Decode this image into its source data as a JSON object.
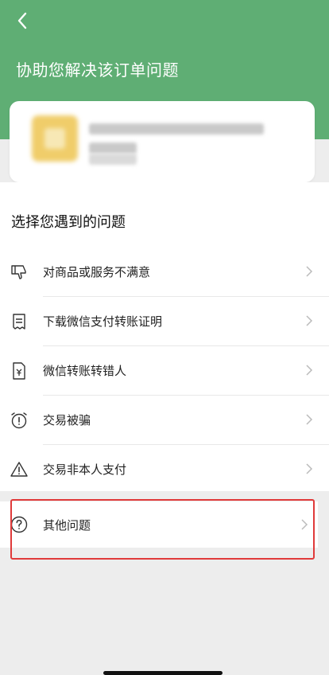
{
  "header": {
    "title": "协助您解决该订单问题",
    "back_icon": "chevron-left-icon",
    "bg_color": "#5fae74"
  },
  "order_card": {
    "thumbnail_icon": "product-thumbnail"
  },
  "section": {
    "title": "选择您遇到的问题"
  },
  "issues": [
    {
      "label": "对商品或服务不满意",
      "icon": "thumbs-down-icon"
    },
    {
      "label": "下载微信支付转账证明",
      "icon": "receipt-icon"
    },
    {
      "label": "微信转账转错人",
      "icon": "yuan-document-icon"
    },
    {
      "label": "交易被骗",
      "icon": "alarm-clock-alert-icon"
    },
    {
      "label": "交易非本人支付",
      "icon": "warning-triangle-icon"
    }
  ],
  "other_issue": {
    "label": "其他问题",
    "icon": "question-circle-icon"
  },
  "highlight_color": "#e03a3a"
}
